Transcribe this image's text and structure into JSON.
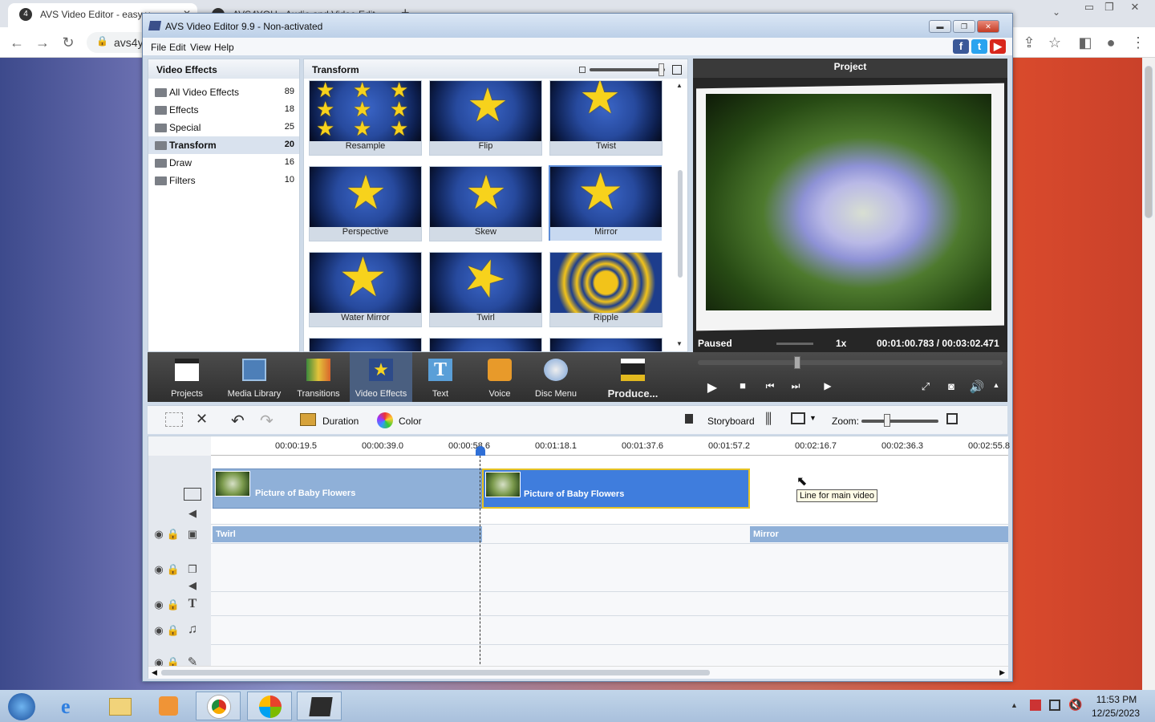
{
  "browser": {
    "tab1_title": "AVS Video Editor - easy v",
    "tab2_title": "AVS4YOU - Audio and Video Edit",
    "address": "avs4y"
  },
  "app": {
    "title": "AVS Video Editor 9.9 - Non-activated",
    "menu": [
      "File",
      "Edit",
      "View",
      "Help"
    ]
  },
  "effects_panel": {
    "title": "Video Effects",
    "categories": [
      {
        "label": "All Video Effects",
        "count": "89"
      },
      {
        "label": "Effects",
        "count": "18"
      },
      {
        "label": "Special",
        "count": "25"
      },
      {
        "label": "Transform",
        "count": "20"
      },
      {
        "label": "Draw",
        "count": "16"
      },
      {
        "label": "Filters",
        "count": "10"
      }
    ]
  },
  "transform_panel": {
    "title": "Transform",
    "effects": [
      "Resample",
      "Flip",
      "Twist",
      "Perspective",
      "Skew",
      "Mirror",
      "Water Mirror",
      "Twirl",
      "Ripple"
    ]
  },
  "preview": {
    "title": "Project",
    "status": "Paused",
    "speed": "1x",
    "time": "00:01:00.783  /  00:03:02.471"
  },
  "toolbar": {
    "items": [
      "Projects",
      "Media Library",
      "Transitions",
      "Video Effects",
      "Text",
      "Voice",
      "Disc Menu",
      "Produce..."
    ]
  },
  "timeline_toolbar": {
    "duration": "Duration",
    "color": "Color",
    "storyboard": "Storyboard",
    "zoom": "Zoom:"
  },
  "timeline": {
    "ruler": [
      "00:00:19.5",
      "00:00:39.0",
      "00:00:58.6",
      "00:01:18.1",
      "00:01:37.6",
      "00:01:57.2",
      "00:02:16.7",
      "00:02:36.3",
      "00:02:55.8"
    ],
    "clip1": "Picture of Baby Flowers",
    "clip2": "Picture of Baby Flowers",
    "effect1": "Twirl",
    "effect2": "Mirror",
    "tooltip": "Line for main video"
  },
  "taskbar": {
    "time": "11:53 PM",
    "date": "12/25/2023"
  }
}
